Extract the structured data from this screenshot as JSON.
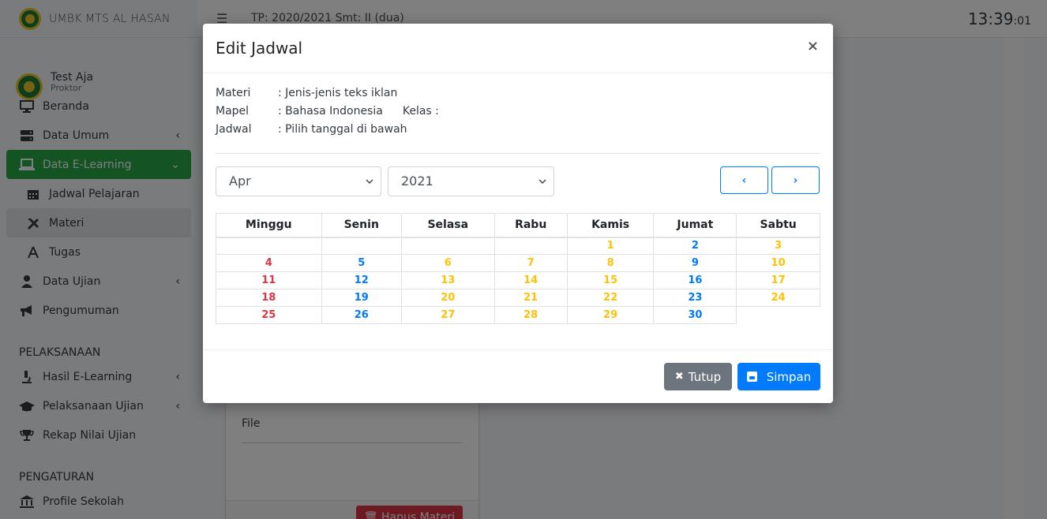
{
  "app": {
    "brand": "UMBK MTS AL HASAN",
    "clock_main": "13:39",
    "clock_seconds": ":01",
    "period": "TP: 2020/2021 Smt: II (dua)"
  },
  "user": {
    "name": "Test Aja",
    "role": "Proktor"
  },
  "sidebar": {
    "items": [
      {
        "label": "Beranda",
        "icon": "monitor-icon"
      },
      {
        "label": "Data Umum",
        "icon": "server-icon"
      },
      {
        "label": "Data E-Learning",
        "icon": "laptop-icon"
      },
      {
        "label": "Jadwal Pelajaran",
        "icon": "calendar-icon"
      },
      {
        "label": "Materi",
        "icon": "tools-icon"
      },
      {
        "label": "Tugas",
        "icon": "compass-icon"
      },
      {
        "label": "Data Ujian",
        "icon": "user-tie-icon"
      },
      {
        "label": "Pengumuman",
        "icon": "megaphone-icon"
      }
    ],
    "header_pelaksanaan": "PELAKSANAAN",
    "items2": [
      {
        "label": "Hasil E-Learning",
        "icon": "microscope-icon"
      },
      {
        "label": "Pelaksanaan Ujian",
        "icon": "graduation-cap-icon"
      },
      {
        "label": "Rekap Nilai Ujian",
        "icon": "trophy-icon"
      }
    ],
    "header_pengaturan": "PENGATURAN",
    "items3": [
      {
        "label": "Profile Sekolah",
        "icon": "bank-icon"
      }
    ]
  },
  "background_card": {
    "file_label": "File",
    "delete_button": "Hapus Materi"
  },
  "modal": {
    "title": "Edit Jadwal",
    "close": "×",
    "info": {
      "materi_label": "Materi",
      "materi_value": ": Jenis-jenis teks iklan",
      "mapel_label": "Mapel",
      "mapel_value": ": Bahasa Indonesia",
      "kelas_label": "Kelas :",
      "jadwal_label": "Jadwal",
      "jadwal_value": ": Pilih tanggal di bawah"
    },
    "month": "Apr",
    "year": "2021",
    "prev_label": "‹",
    "next_label": "›",
    "days": [
      "Minggu",
      "Senin",
      "Selasa",
      "Rabu",
      "Kamis",
      "Jumat",
      "Sabtu"
    ],
    "weeks": [
      [
        "",
        "",
        "",
        "",
        "1",
        "2",
        "3"
      ],
      [
        "4",
        "5",
        "6",
        "7",
        "8",
        "9",
        "10"
      ],
      [
        "11",
        "12",
        "13",
        "14",
        "15",
        "16",
        "17"
      ],
      [
        "18",
        "19",
        "20",
        "21",
        "22",
        "23",
        "24"
      ],
      [
        "25",
        "26",
        "27",
        "28",
        "29",
        "30",
        ""
      ]
    ],
    "colors": {
      "sunday": "#dc3545",
      "monday_friday": "#007bff",
      "other_days": "#ffc107"
    },
    "btn_tutup": "Tutup",
    "btn_simpan": "Simpan"
  }
}
